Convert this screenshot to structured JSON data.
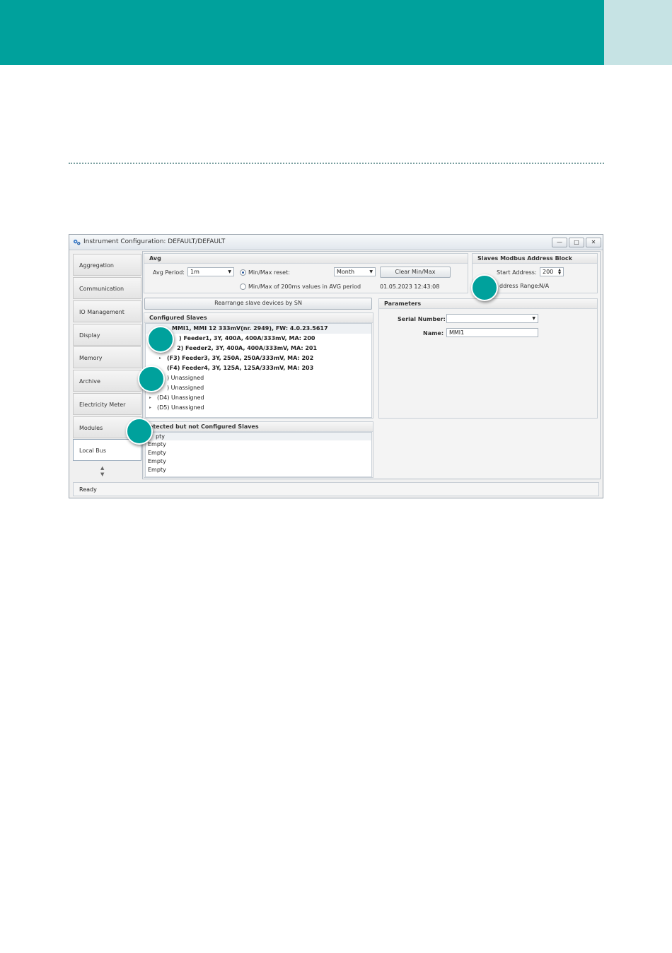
{
  "window": {
    "title": "Instrument Configuration: DEFAULT/DEFAULT",
    "controls": {
      "minimize": "—",
      "maximize": "□",
      "close": "✕"
    }
  },
  "nav": {
    "items": [
      "Aggregation",
      "Communication",
      "IO Management",
      "Display",
      "Memory",
      "Archive",
      "Electricity Meter",
      "Modules",
      "Local Bus"
    ],
    "active": "Local Bus",
    "scroll_up": "▲",
    "scroll_down": "▼"
  },
  "avg": {
    "title": "Avg",
    "period_label": "Avg Period:",
    "period_value": "1m",
    "minmax_reset_label": "Min/Max reset:",
    "minmax_reset_value": "Month",
    "clear_button": "Clear Min/Max",
    "minmax_200ms_label": "Min/Max of 200ms values in AVG period",
    "timestamp": "01.05.2023 12:43:08"
  },
  "modbus": {
    "title": "Slaves Modbus Address Block",
    "start_label": "Start Address:",
    "start_value": "200",
    "range_label": "ddress Range:",
    "range_value": "N/A"
  },
  "rearrange_button": "Rearrange slave devices by SN",
  "configured": {
    "title": "Configured Slaves",
    "rows": [
      "MMI1, MMI 12 333mV(nr. 2949), FW: 4.0.23.5617",
      ") Feeder1, 3Y, 400A, 400A/333mV, MA: 200",
      "2) Feeder2, 3Y, 400A, 400A/333mV, MA: 201",
      "(F3) Feeder3, 3Y, 250A, 250A/333mV, MA: 202",
      "(F4) Feeder4, 3Y, 125A, 125A/333mV, MA: 203",
      ") Unassigned",
      ") Unassigned",
      "(D4) Unassigned",
      "(D5) Unassigned"
    ]
  },
  "detected": {
    "title": "etected but not Configured Slaves",
    "rows": [
      "pty",
      "Empty",
      "Empty",
      "Empty",
      "Empty"
    ]
  },
  "parameters": {
    "title": "Parameters",
    "serial_label": "Serial Number:",
    "serial_value": "",
    "name_label": "Name:",
    "name_value": "MMI1"
  },
  "status": "Ready",
  "colors": {
    "brand": "#00a19c",
    "tab": "#c6e3e4"
  }
}
